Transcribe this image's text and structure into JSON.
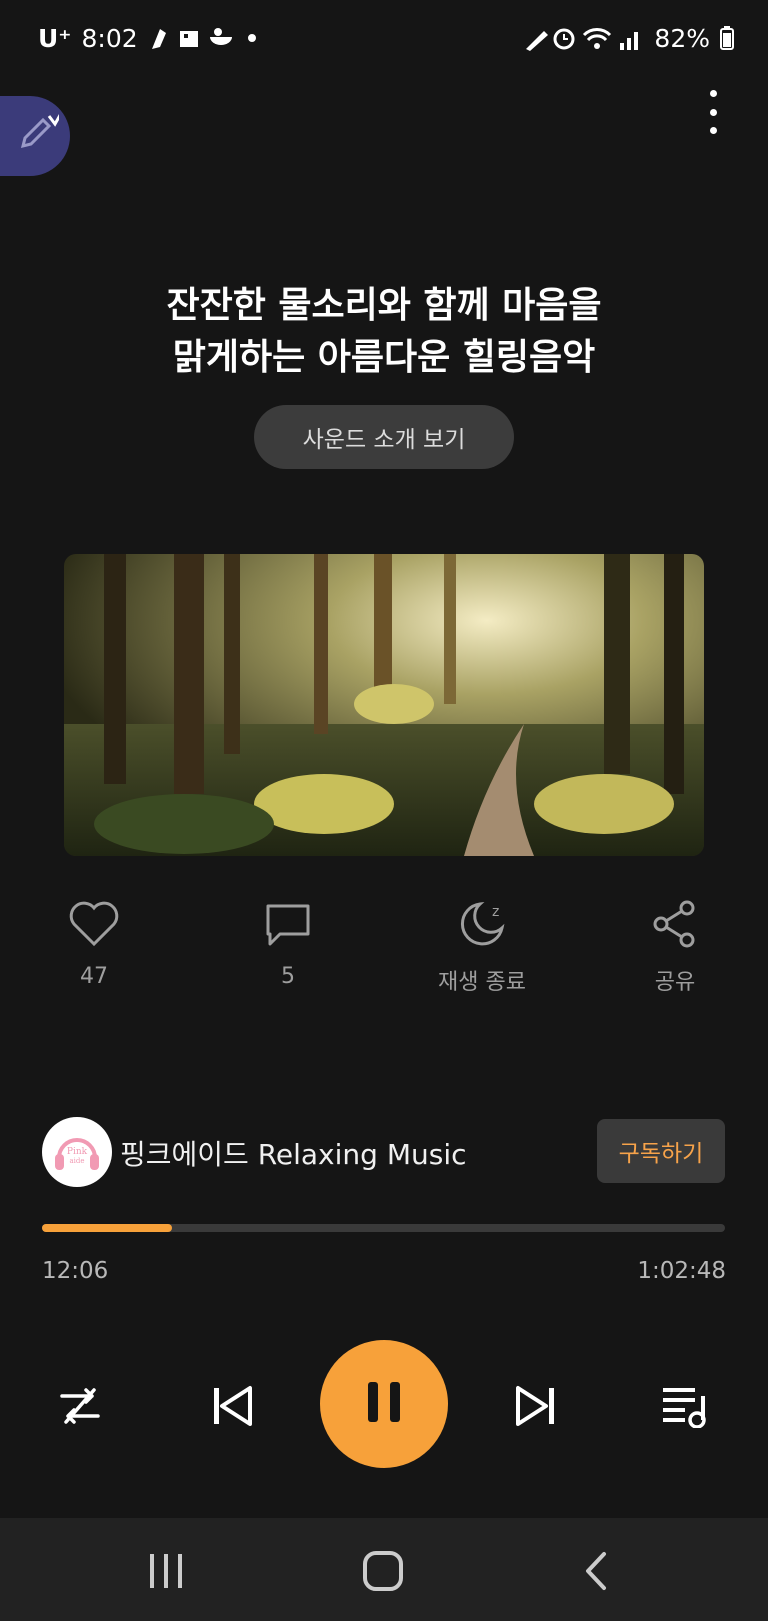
{
  "status": {
    "carrier": "U⁺",
    "time": "8:02",
    "battery": "82%"
  },
  "track": {
    "title_line1": "잔잔한 물소리와 함께 마음을",
    "title_line2": "맑게하는 아름다운 힐링음악",
    "intro_button": "사운드 소개 보기"
  },
  "actions": {
    "likes": "47",
    "comments": "5",
    "sleep_timer": "재생 종료",
    "share": "공유"
  },
  "channel": {
    "name": "핑크에이드 Relaxing Music",
    "subscribe": "구독하기",
    "logo_text": "Pink aide"
  },
  "player": {
    "current_time": "12:06",
    "total_time": "1:02:48",
    "progress": 0.19,
    "accent_color": "#f7a13a"
  },
  "icons": [
    "heart-icon",
    "comment-icon",
    "moon-icon",
    "share-icon",
    "shuffle-icon",
    "previous-icon",
    "pause-icon",
    "next-icon",
    "playlist-icon",
    "more-icon",
    "edit-icon"
  ]
}
